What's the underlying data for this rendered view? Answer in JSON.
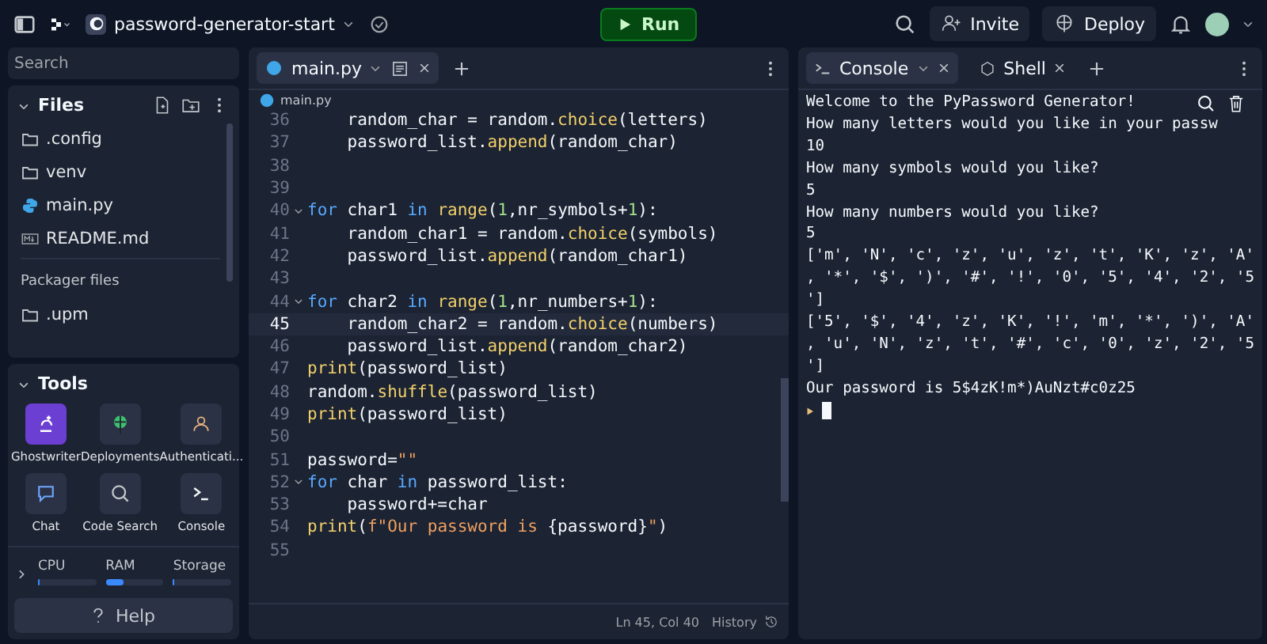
{
  "topbar": {
    "project": "password-generator-start",
    "run": "Run",
    "invite": "Invite",
    "deploy": "Deploy"
  },
  "sidebar": {
    "search": {
      "placeholder": "Search"
    },
    "files_title": "Files",
    "files": [
      {
        "name": ".config",
        "kind": "folder"
      },
      {
        "name": "venv",
        "kind": "folder"
      },
      {
        "name": "main.py",
        "kind": "python"
      },
      {
        "name": "README.md",
        "kind": "markdown"
      }
    ],
    "packager_title": "Packager files",
    "packager_files": [
      {
        "name": ".upm",
        "kind": "folder"
      }
    ],
    "tools_title": "Tools",
    "tools": [
      {
        "label": "Ghostwriter",
        "selected": true
      },
      {
        "label": "Deployments",
        "selected": false
      },
      {
        "label": "Authenticati...",
        "selected": false
      },
      {
        "label": "Chat",
        "selected": false
      },
      {
        "label": "Code Search",
        "selected": false
      },
      {
        "label": "Console",
        "selected": false
      }
    ],
    "meters": [
      {
        "label": "CPU",
        "level": 0.02
      },
      {
        "label": "RAM",
        "level": 0.3
      },
      {
        "label": "Storage",
        "level": 0.02
      }
    ],
    "help": "Help"
  },
  "editor": {
    "tab": "main.py",
    "breadcrumb": "main.py",
    "lines": [
      {
        "number": "36",
        "selected": false,
        "foldable": false,
        "tokens": [
          {
            "text": "    random_char = random.",
            "kind": "plain"
          },
          {
            "text": "choice",
            "kind": "func"
          },
          {
            "text": "(letters)",
            "kind": "plain"
          }
        ]
      },
      {
        "number": "37",
        "selected": false,
        "foldable": false,
        "tokens": [
          {
            "text": "    password_list.",
            "kind": "plain"
          },
          {
            "text": "append",
            "kind": "func"
          },
          {
            "text": "(random_char)",
            "kind": "plain"
          }
        ]
      },
      {
        "number": "38",
        "selected": false,
        "foldable": false
      },
      {
        "number": "39",
        "selected": false,
        "foldable": false
      },
      {
        "number": "40",
        "selected": false,
        "foldable": true,
        "tokens": [
          {
            "text": "for",
            "kind": "keyword"
          },
          {
            "text": " char1 ",
            "kind": "plain"
          },
          {
            "text": "in",
            "kind": "keyword"
          },
          {
            "text": " range",
            "kind": "func"
          },
          {
            "text": "(",
            "kind": "plain"
          },
          {
            "text": "1",
            "kind": "number"
          },
          {
            "text": ",nr_symbols+",
            "kind": "plain"
          },
          {
            "text": "1",
            "kind": "number"
          },
          {
            "text": "):",
            "kind": "plain"
          }
        ]
      },
      {
        "number": "41",
        "selected": false,
        "foldable": false,
        "tokens": [
          {
            "text": "    random_char1 = random.",
            "kind": "plain"
          },
          {
            "text": "choice",
            "kind": "func"
          },
          {
            "text": "(symbols)",
            "kind": "plain"
          }
        ]
      },
      {
        "number": "42",
        "selected": false,
        "foldable": false,
        "tokens": [
          {
            "text": "    password_list.",
            "kind": "plain"
          },
          {
            "text": "append",
            "kind": "func"
          },
          {
            "text": "(random_char1)",
            "kind": "plain"
          }
        ]
      },
      {
        "number": "43",
        "selected": false,
        "foldable": false
      },
      {
        "number": "44",
        "selected": false,
        "foldable": true,
        "tokens": [
          {
            "text": "for",
            "kind": "keyword"
          },
          {
            "text": " char2 ",
            "kind": "plain"
          },
          {
            "text": "in",
            "kind": "keyword"
          },
          {
            "text": " range",
            "kind": "func"
          },
          {
            "text": "(",
            "kind": "plain"
          },
          {
            "text": "1",
            "kind": "number"
          },
          {
            "text": ",nr_numbers+",
            "kind": "plain"
          },
          {
            "text": "1",
            "kind": "number"
          },
          {
            "text": "):",
            "kind": "plain"
          }
        ]
      },
      {
        "number": "45",
        "selected": true,
        "foldable": false,
        "tokens": [
          {
            "text": "    random_char2 = random.",
            "kind": "plain"
          },
          {
            "text": "choice",
            "kind": "func"
          },
          {
            "text": "(numbers)",
            "kind": "plain"
          }
        ]
      },
      {
        "number": "46",
        "selected": false,
        "foldable": false,
        "tokens": [
          {
            "text": "    password_list.",
            "kind": "plain"
          },
          {
            "text": "append",
            "kind": "func"
          },
          {
            "text": "(random_char2)",
            "kind": "plain"
          }
        ]
      },
      {
        "number": "47",
        "selected": false,
        "foldable": false,
        "tokens": [
          {
            "text": "print",
            "kind": "func"
          },
          {
            "text": "(password_list)",
            "kind": "plain"
          }
        ]
      },
      {
        "number": "48",
        "selected": false,
        "foldable": false,
        "tokens": [
          {
            "text": "random.",
            "kind": "plain"
          },
          {
            "text": "shuffle",
            "kind": "func"
          },
          {
            "text": "(password_list)",
            "kind": "plain"
          }
        ]
      },
      {
        "number": "49",
        "selected": false,
        "foldable": false,
        "tokens": [
          {
            "text": "print",
            "kind": "func"
          },
          {
            "text": "(password_list)",
            "kind": "plain"
          }
        ]
      },
      {
        "number": "50",
        "selected": false,
        "foldable": false
      },
      {
        "number": "51",
        "selected": false,
        "foldable": false,
        "tokens": [
          {
            "text": "password=",
            "kind": "plain"
          },
          {
            "text": "\"\"",
            "kind": "string"
          }
        ]
      },
      {
        "number": "52",
        "selected": false,
        "foldable": true,
        "tokens": [
          {
            "text": "for",
            "kind": "keyword"
          },
          {
            "text": " char ",
            "kind": "plain"
          },
          {
            "text": "in",
            "kind": "keyword"
          },
          {
            "text": " password_list:",
            "kind": "plain"
          }
        ]
      },
      {
        "number": "53",
        "selected": false,
        "foldable": false,
        "tokens": [
          {
            "text": "    password+=char",
            "kind": "plain"
          }
        ]
      },
      {
        "number": "54",
        "selected": false,
        "foldable": false,
        "tokens": [
          {
            "text": "print",
            "kind": "func"
          },
          {
            "text": "(",
            "kind": "plain"
          },
          {
            "text": "f\"Our password is ",
            "kind": "string"
          },
          {
            "text": "{password}",
            "kind": "plain"
          },
          {
            "text": "\"",
            "kind": "string"
          },
          {
            "text": ")",
            "kind": "plain"
          }
        ]
      },
      {
        "number": "55",
        "selected": false,
        "foldable": false
      }
    ],
    "status": "Ln 45, Col 40",
    "history": "History"
  },
  "console": {
    "tabs": [
      {
        "label": "Console",
        "selected": true
      },
      {
        "label": "Shell",
        "selected": false
      }
    ],
    "lines": [
      "Welcome to the PyPassword Generator!",
      "How many letters would you like in your passw",
      "10",
      "How many symbols would you like?",
      "5",
      "How many numbers would you like?",
      "5",
      "['m', 'N', 'c', 'z', 'u', 'z', 't', 'K', 'z', 'A'",
      ", '*', '$', ')', '#', '!', '0', '5', '4', '2', '5",
      "']",
      "['5', '$', '4', 'z', 'K', '!', 'm', '*', ')', 'A'",
      ", 'u', 'N', 'z', 't', '#', 'c', '0', 'z', '2', '5",
      "']",
      "Our password is 5$4zK!m*)AuNzt#c0z25"
    ]
  }
}
